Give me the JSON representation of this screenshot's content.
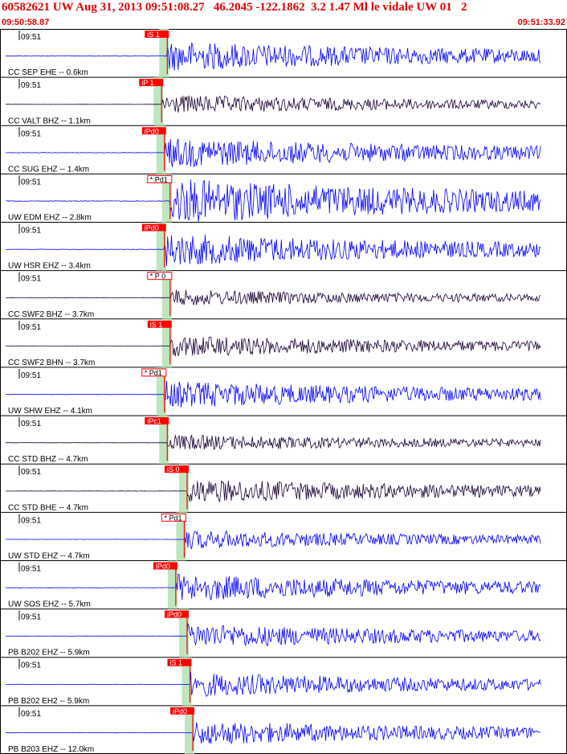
{
  "header": {
    "title": "60582621 UW Aug 31, 2013 09:51:08.27   46.2045 -122.1862  3.2 1.47 Ml le vidale UW 01   2",
    "start_time": "09:50:58.87",
    "end_time": "09:51:33.92"
  },
  "colors": {
    "header_text": "#e00000",
    "trace_blue": "#0000ff",
    "trace_dark": "#1a0033",
    "pick_red": "#ff0000",
    "green_band": "#b3e0b3",
    "grid_black": "#000000"
  },
  "chart_data": {
    "type": "seismogram",
    "x_range": [
      "09:50:58.87",
      "09:51:33.92"
    ],
    "minute_label": "09:51",
    "channels": [
      {
        "label": "CC SEP EHE -- 0.6km",
        "pick": "iS 1",
        "pick_style": "filled",
        "color": "#0000ff",
        "amplitude": 0.55,
        "onset": 0.295
      },
      {
        "label": "CC VALT BHZ -- 1.1km",
        "pick": "iP 1",
        "pick_style": "filled",
        "color": "#1a0033",
        "amplitude": 0.35,
        "onset": 0.285
      },
      {
        "label": "CC SUG EHZ -- 1.4km",
        "pick": "iPd0",
        "pick_style": "filled",
        "color": "#0000ff",
        "amplitude": 0.55,
        "onset": 0.29
      },
      {
        "label": "UW EDM EHZ -- 2.8km",
        "pick": "* Pd1",
        "pick_style": "outline",
        "color": "#0000ff",
        "amplitude": 0.85,
        "onset": 0.3
      },
      {
        "label": "UW HSR EHZ -- 3.4km",
        "pick": "iPd0",
        "pick_style": "filled",
        "color": "#0000ff",
        "amplitude": 0.6,
        "onset": 0.29
      },
      {
        "label": "CC SWF2 BHZ -- 3.7km",
        "pick": "* P 0",
        "pick_style": "outline",
        "color": "#1a0033",
        "amplitude": 0.3,
        "onset": 0.3
      },
      {
        "label": "CC SWF2 BHN -- 3.7km",
        "pick": "iS 1",
        "pick_style": "filled",
        "color": "#1a0033",
        "amplitude": 0.4,
        "onset": 0.3
      },
      {
        "label": "UW SHW EHZ -- 4.1km",
        "pick": "* Pd1",
        "pick_style": "outline",
        "color": "#0000ff",
        "amplitude": 0.5,
        "onset": 0.29
      },
      {
        "label": "CC STD BHZ -- 4.7km",
        "pick": "iPc1",
        "pick_style": "filled",
        "color": "#1a0033",
        "amplitude": 0.3,
        "onset": 0.295
      },
      {
        "label": "CC STD BHE -- 4.7km",
        "pick": "iS 0",
        "pick_style": "filled",
        "color": "#1a0033",
        "amplitude": 0.45,
        "onset": 0.33
      },
      {
        "label": "UW STD EHZ -- 4.7km",
        "pick": "* Pd1",
        "pick_style": "outline",
        "color": "#0000ff",
        "amplitude": 0.35,
        "onset": 0.325
      },
      {
        "label": "UW SOS EHZ -- 5.7km",
        "pick": "iPd0",
        "pick_style": "filled",
        "color": "#0000ff",
        "amplitude": 0.5,
        "onset": 0.31
      },
      {
        "label": "PB B202 EHZ -- 5.9km",
        "pick": "iPd0",
        "pick_style": "filled",
        "color": "#0000ff",
        "amplitude": 0.45,
        "onset": 0.33
      },
      {
        "label": "PB B202 EH2 -- 5.9km",
        "pick": "iS 1",
        "pick_style": "filled",
        "color": "#0000ff",
        "amplitude": 0.45,
        "onset": 0.335
      },
      {
        "label": "PB B203 EHZ -- 12.0km",
        "pick": "iPd0",
        "pick_style": "filled",
        "color": "#0000ff",
        "amplitude": 0.45,
        "onset": 0.34
      }
    ]
  }
}
